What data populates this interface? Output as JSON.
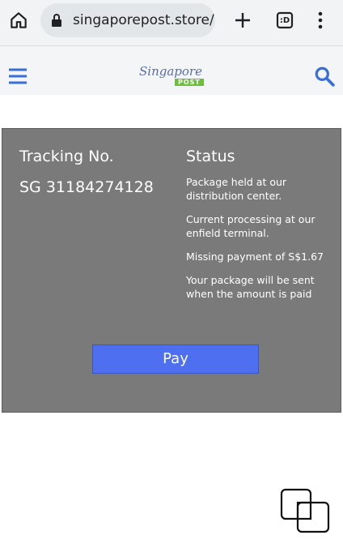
{
  "browser": {
    "url": "singaporepost.store/",
    "icons": [
      "home-icon",
      "lock-icon",
      "plus-icon",
      "tab-switcher-icon",
      "more-vert-icon"
    ],
    "tab_count": ":D"
  },
  "site": {
    "logo_text_main": "Singapore",
    "logo_text_sub": "POST",
    "icons": [
      "hamburger-menu-icon",
      "search-icon"
    ],
    "accent_color": "#3a6fd6"
  },
  "tracking": {
    "tracking_label": "Tracking No.",
    "tracking_number": "SG 31184274128",
    "status_label": "Status",
    "status_lines": [
      "Package held at our distribution center.",
      "Current processing at our enfield terminal.",
      "Missing payment of S$1.67",
      "Your package will be sent when the amount is paid"
    ],
    "pay_label": "Pay",
    "panel_color": "#7a7a7a",
    "button_color": "#4d6ff0"
  },
  "overlay": {
    "icon": "overlapping-squares-icon"
  }
}
